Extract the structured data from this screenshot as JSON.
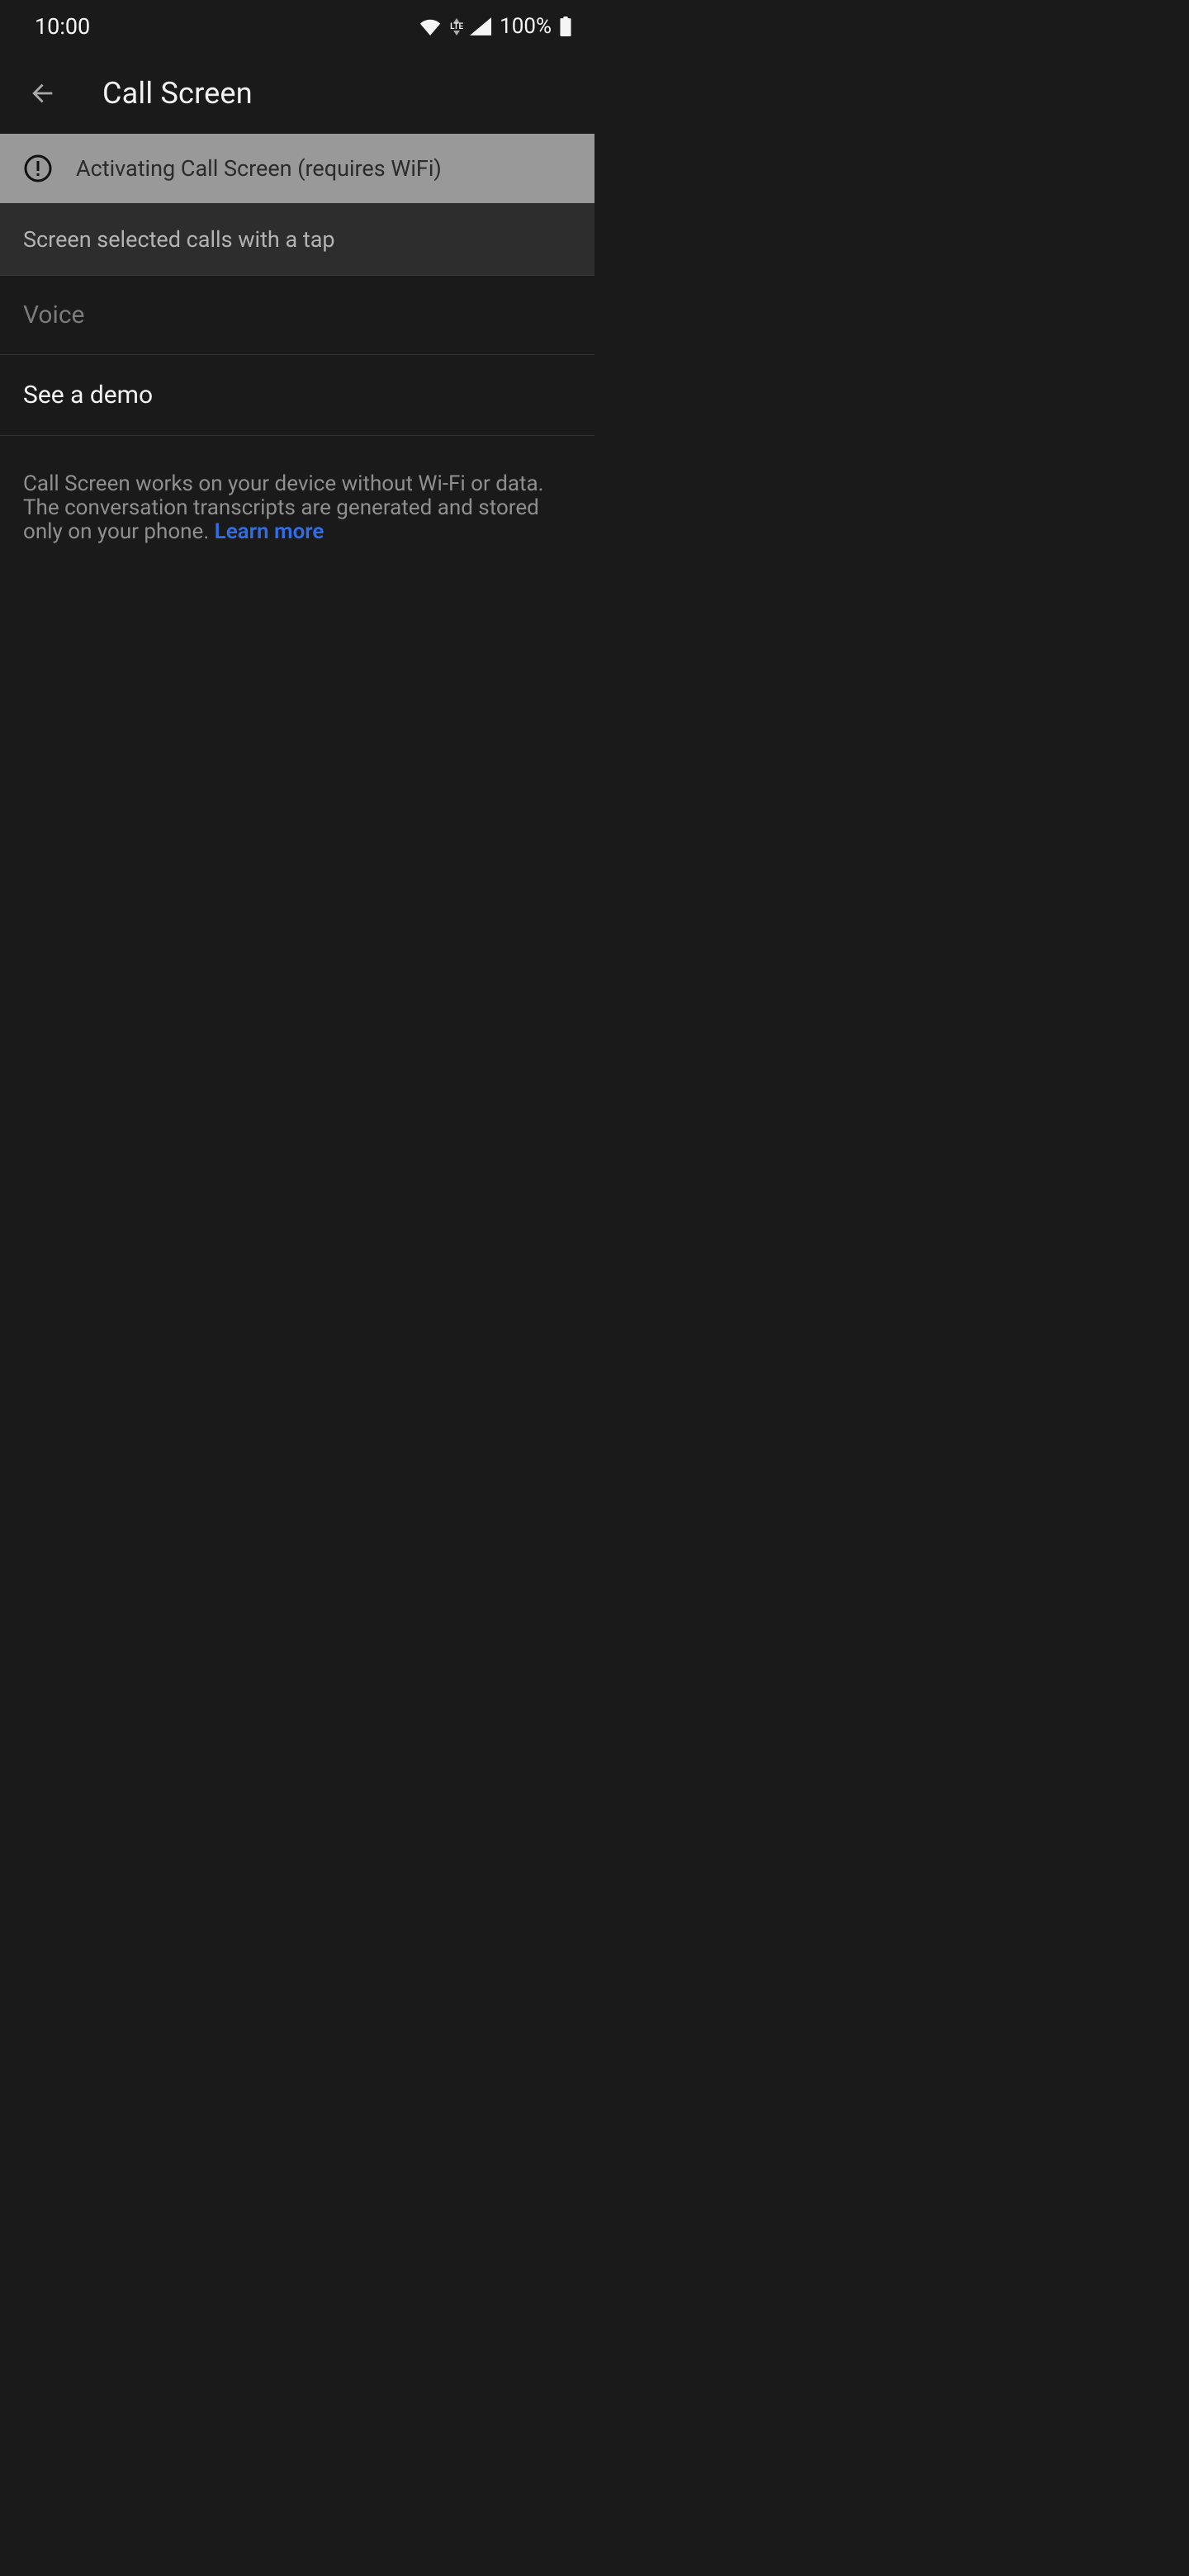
{
  "status_bar": {
    "time": "10:00",
    "network_label": "LTE",
    "battery_percent": "100%"
  },
  "header": {
    "title": "Call Screen"
  },
  "banner": {
    "message": "Activating Call Screen (requires WiFi)"
  },
  "section": {
    "subtitle": "Screen selected calls with a tap"
  },
  "voice": {
    "label": "Voice"
  },
  "demo": {
    "label": "See a demo"
  },
  "footer": {
    "body": "Call Screen works on your device without Wi-Fi or data. The conversation transcripts are generated and stored only on your phone. ",
    "learn_more": "Learn more"
  }
}
